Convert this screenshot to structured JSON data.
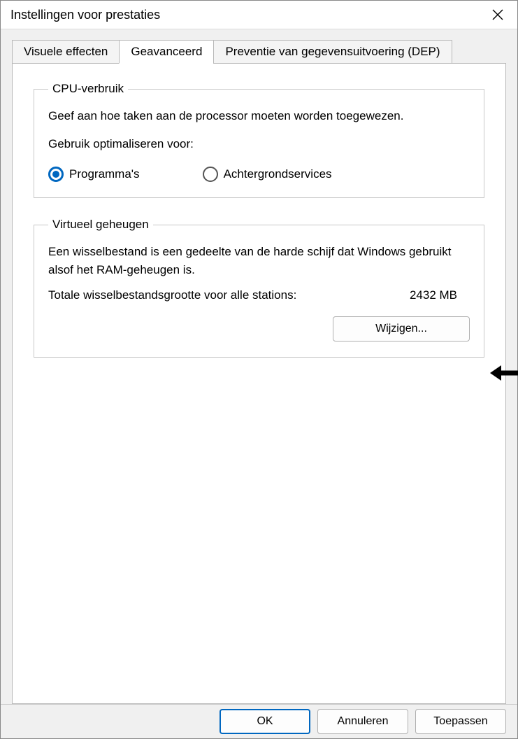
{
  "window": {
    "title": "Instellingen voor prestaties"
  },
  "tabs": {
    "visual_effects": "Visuele effecten",
    "advanced": "Geavanceerd",
    "dep": "Preventie van gegevensuitvoering (DEP)"
  },
  "cpu_group": {
    "legend": "CPU-verbruik",
    "description": "Geef aan hoe taken aan de processor moeten worden toegewezen.",
    "optimize_label": "Gebruik optimaliseren voor:",
    "option_programs": "Programma's",
    "option_background": "Achtergrondservices"
  },
  "vm_group": {
    "legend": "Virtueel geheugen",
    "description": "Een wisselbestand is een gedeelte van de harde schijf dat Windows gebruikt alsof het RAM-geheugen is.",
    "total_label": "Totale wisselbestandsgrootte voor alle stations:",
    "total_value": "2432 MB",
    "change_button": "Wijzigen..."
  },
  "footer": {
    "ok": "OK",
    "cancel": "Annuleren",
    "apply": "Toepassen"
  }
}
